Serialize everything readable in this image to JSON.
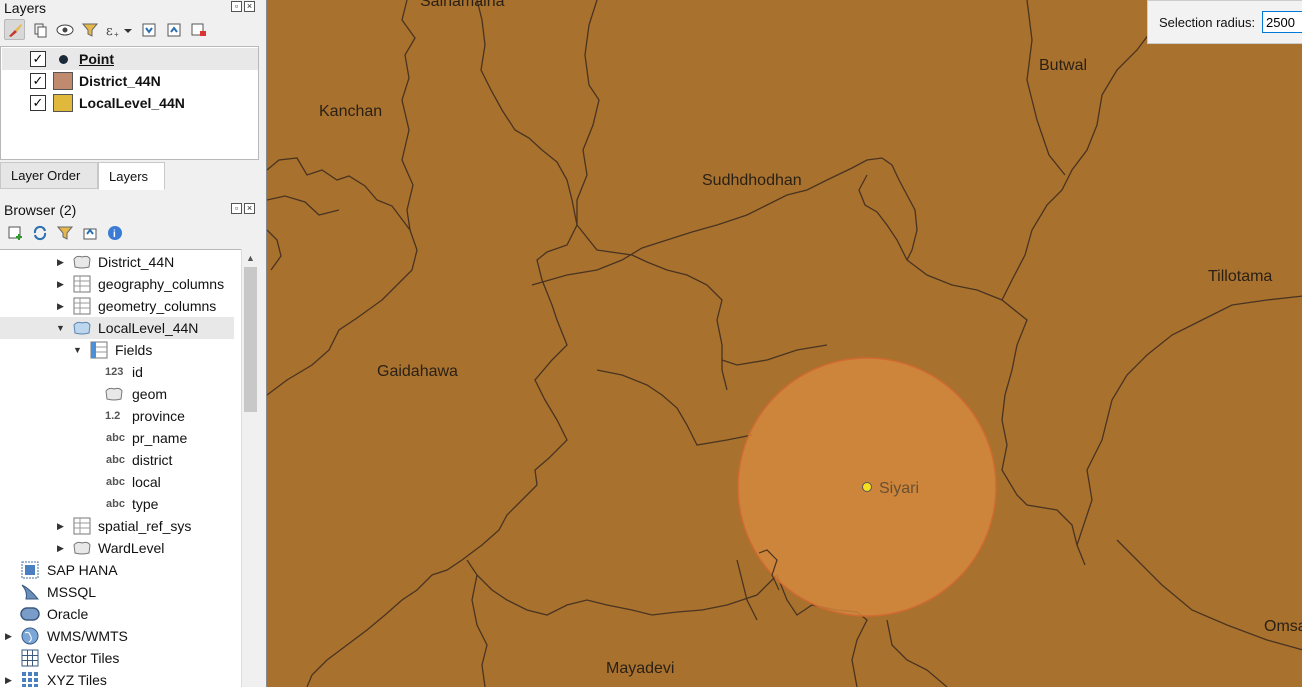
{
  "layers_panel": {
    "title": "Layers",
    "items": [
      {
        "name": "Point",
        "checked": true,
        "color": "#1a2a3a"
      },
      {
        "name": "District_44N",
        "checked": true,
        "color": "#c08a6e"
      },
      {
        "name": "LocalLevel_44N",
        "checked": true,
        "color": "#e0b93c"
      }
    ]
  },
  "tabs": {
    "layer_order": "Layer Order",
    "layers": "Layers"
  },
  "browser_panel": {
    "title": "Browser (2)",
    "tree": {
      "district": "District_44N",
      "geography_columns": "geography_columns",
      "geometry_columns": "geometry_columns",
      "local_level": "LocalLevel_44N",
      "fields": "Fields",
      "field_items": [
        {
          "type": "123",
          "name": "id"
        },
        {
          "type": "",
          "name": "geom"
        },
        {
          "type": "1.2",
          "name": "province"
        },
        {
          "type": "abc",
          "name": "pr_name"
        },
        {
          "type": "abc",
          "name": "district"
        },
        {
          "type": "abc",
          "name": "local"
        },
        {
          "type": "abc",
          "name": "type"
        }
      ],
      "spatial_ref_sys": "spatial_ref_sys",
      "ward_level": "WardLevel",
      "providers": [
        "SAP HANA",
        "MSSQL",
        "Oracle",
        "WMS/WMTS",
        "Vector Tiles",
        "XYZ Tiles"
      ]
    }
  },
  "map": {
    "background": "#a8722e",
    "labels": {
      "sainamaina": "Sainamaina",
      "butwal": "Butwal",
      "kanchan": "Kanchan",
      "sudhdhodhan": "Sudhdhodhan",
      "tillotama": "Tillotama",
      "gaidahawa": "Gaidahawa",
      "siyari": "Siyari",
      "mayadevi": "Mayadevi",
      "omsa": "Omsa"
    },
    "selection_circle_color": "#d68a40",
    "point_color": "#f5e020"
  },
  "selection_radius": {
    "label": "Selection radius:",
    "value": "2500"
  }
}
